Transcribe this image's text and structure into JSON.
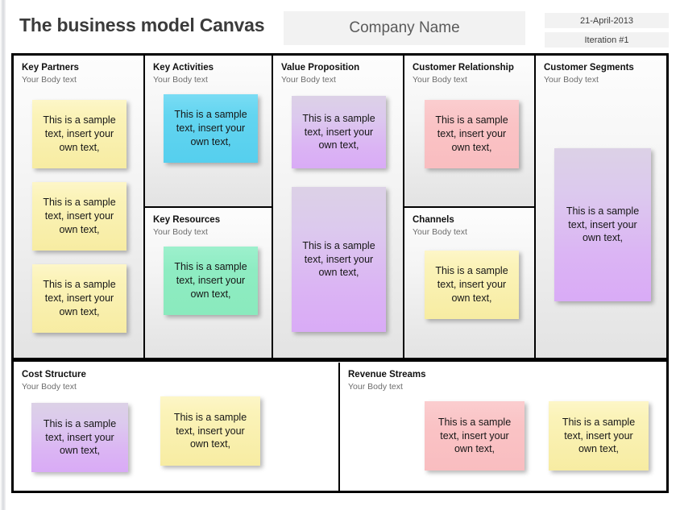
{
  "header": {
    "title": "The business model Canvas",
    "company_name": "Company Name",
    "date": "21-April-2013",
    "iteration": "Iteration #1"
  },
  "note_text": "This is a sample text, insert your own text,",
  "body_text": "Your Body text",
  "colors": {
    "yellow": "#f9efae",
    "blue": "#5fd2ef",
    "green": "#8eecc2",
    "pink": "#fac3c5",
    "purple": "#dbb4f4",
    "frame": "#000000",
    "block_bg": "#f0f0f0",
    "header_box": "#f2f2f2"
  },
  "blocks": {
    "key_partners": {
      "title": "Key Partners",
      "subtitle": "Your Body text",
      "notes": [
        {
          "color": "yellow",
          "text": "This is a sample text, insert your own text,"
        },
        {
          "color": "yellow",
          "text": "This is a sample text, insert your own text,"
        },
        {
          "color": "yellow",
          "text": "This is a sample text, insert your own text,"
        }
      ]
    },
    "key_activities": {
      "title": "Key Activities",
      "subtitle": "Your Body text",
      "notes": [
        {
          "color": "blue",
          "text": "This is a sample text, insert your own text,"
        }
      ]
    },
    "key_resources": {
      "title": "Key Resources",
      "subtitle": "Your Body text",
      "notes": [
        {
          "color": "green",
          "text": "This is a sample text, insert your own text,"
        }
      ]
    },
    "value_proposition": {
      "title": "Value Proposition",
      "subtitle": "Your Body text",
      "notes": [
        {
          "color": "purple",
          "text": "This is a sample text, insert your own text,"
        },
        {
          "color": "purple",
          "text": "This is a sample text, insert your own text,"
        }
      ]
    },
    "customer_relationship": {
      "title": "Customer Relationship",
      "subtitle": "Your Body text",
      "notes": [
        {
          "color": "pink",
          "text": "This is a sample text, insert your own text,"
        }
      ]
    },
    "channels": {
      "title": "Channels",
      "subtitle": "Your Body text",
      "notes": [
        {
          "color": "yellow",
          "text": "This is a sample text, insert your own text,"
        }
      ]
    },
    "customer_segments": {
      "title": "Customer Segments",
      "subtitle": "Your Body text",
      "notes": [
        {
          "color": "purple",
          "text": "This is a sample text, insert your own text,"
        }
      ]
    },
    "cost_structure": {
      "title": "Cost Structure",
      "subtitle": "Your Body text",
      "notes": [
        {
          "color": "purple",
          "text": "This is a sample text, insert your own text,"
        },
        {
          "color": "yellow",
          "text": "This is a sample text, insert your own text,"
        }
      ]
    },
    "revenue_streams": {
      "title": "Revenue Streams",
      "subtitle": "Your Body text",
      "notes": [
        {
          "color": "pink",
          "text": "This is a sample text, insert your own text,"
        },
        {
          "color": "yellow",
          "text": "This is a sample text, insert your own text,"
        }
      ]
    }
  }
}
